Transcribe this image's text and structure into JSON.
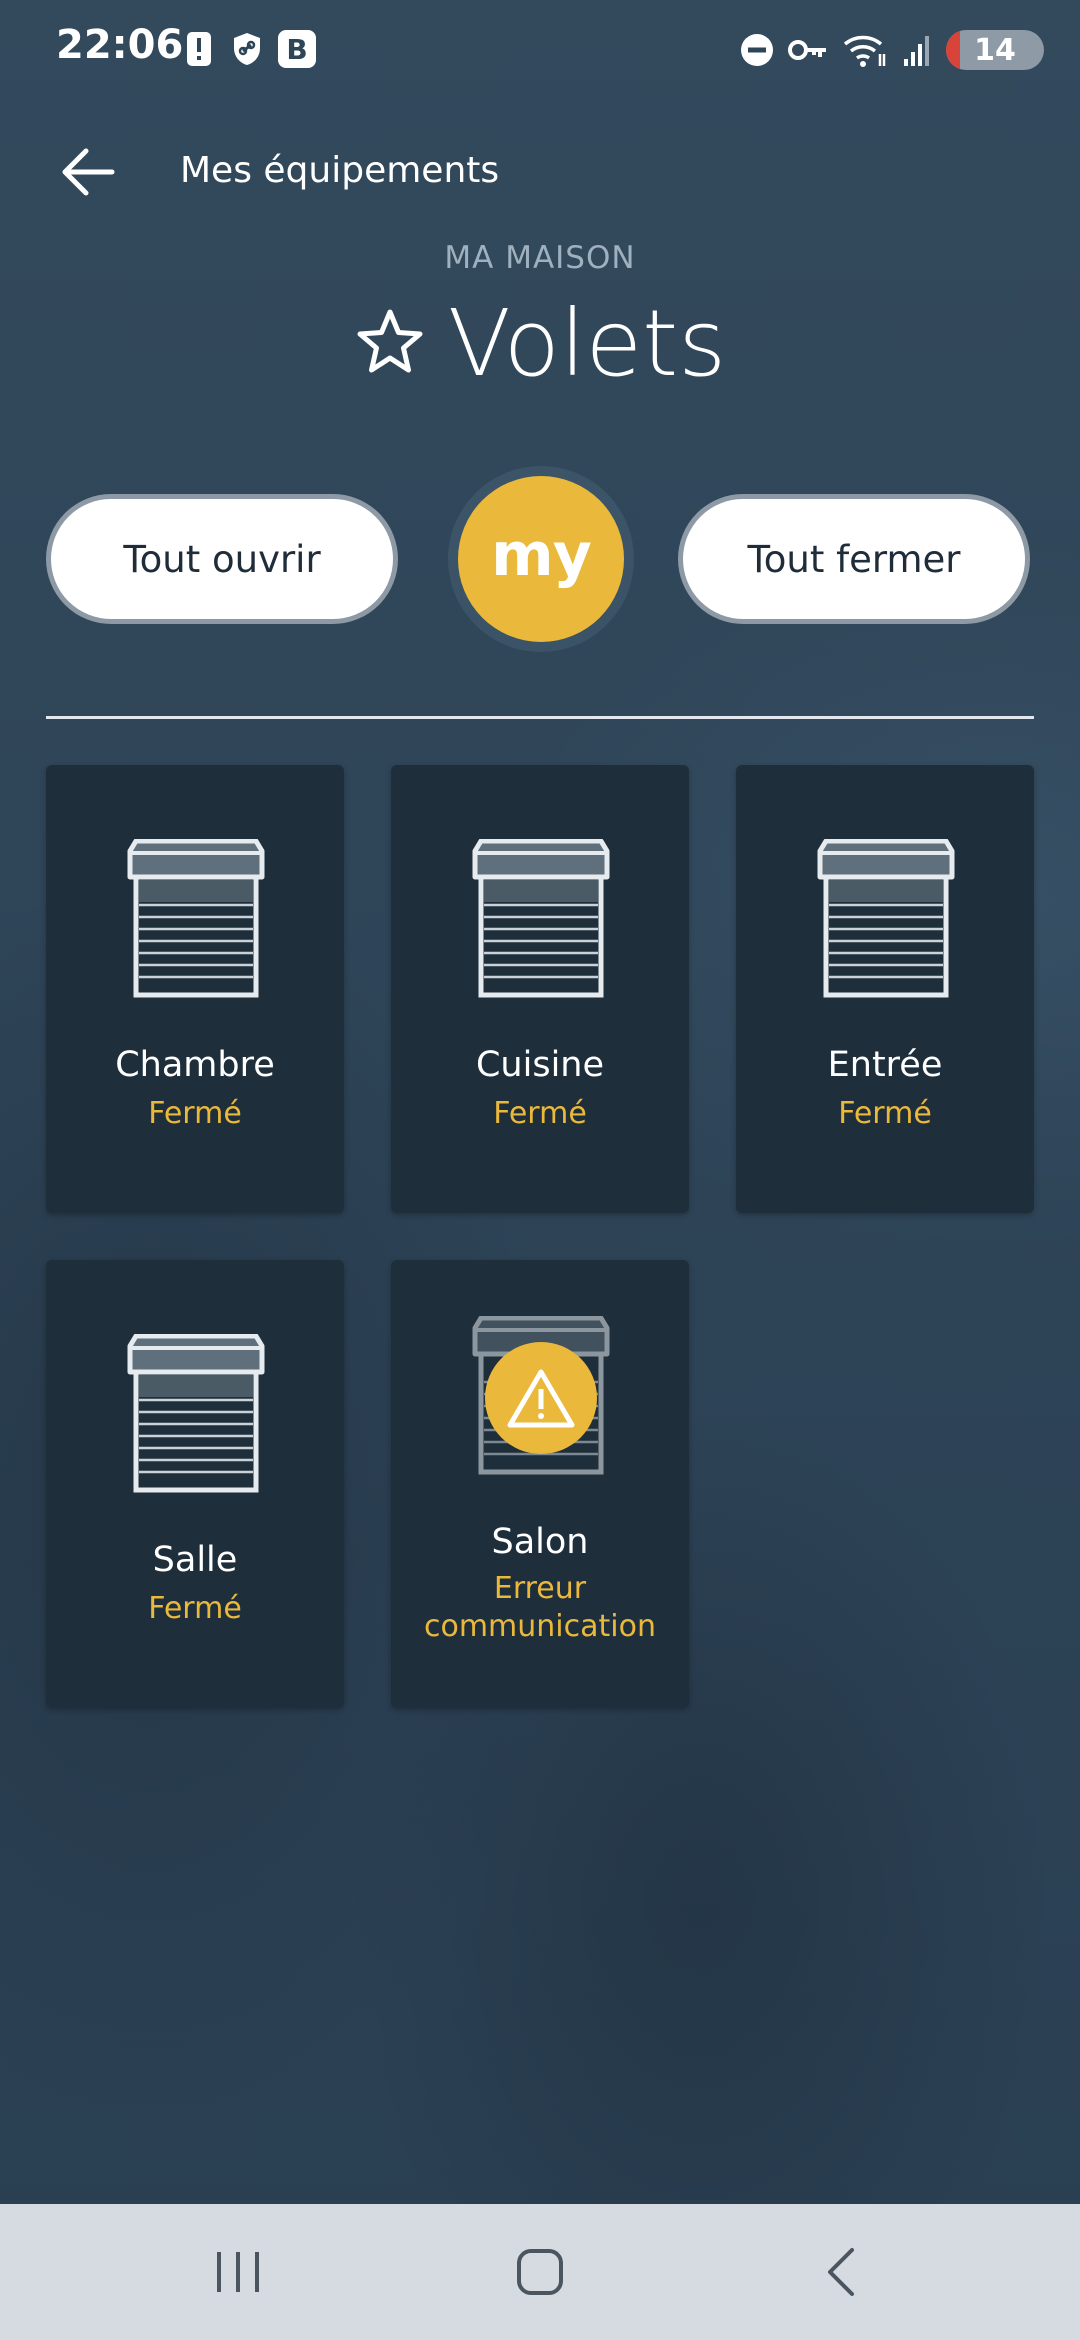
{
  "status_bar": {
    "time": "22:06",
    "left_icons": [
      "alert-icon",
      "shield-link-icon",
      "b-app-icon"
    ],
    "b_badge": "B",
    "right_icons": [
      "dnd-icon",
      "vpn-key-icon",
      "wifi-icon",
      "signal-icon"
    ],
    "battery": "14"
  },
  "header": {
    "back_icon": "arrow-left-icon",
    "title": "Mes équipements"
  },
  "page": {
    "subtitle": "MA MAISON",
    "title": "Volets",
    "favorite_icon": "star-outline-icon"
  },
  "actions": {
    "open_all": "Tout ouvrir",
    "my_label": "my",
    "close_all": "Tout fermer"
  },
  "colors": {
    "accent": "#eab83a",
    "background": "#2e4457",
    "tile": "#1f2e3b"
  },
  "devices": [
    {
      "name": "Chambre",
      "state": "Fermé",
      "icon": "roller-shutter-icon"
    },
    {
      "name": "Cuisine",
      "state": "Fermé",
      "icon": "roller-shutter-icon"
    },
    {
      "name": "Entrée",
      "state": "Fermé",
      "icon": "roller-shutter-icon"
    },
    {
      "name": "Salle",
      "state": "Fermé",
      "icon": "roller-shutter-icon"
    },
    {
      "name": "Salon",
      "state": "Erreur communication",
      "icon": "warning-icon"
    }
  ],
  "nav": {
    "recents": "recents-icon",
    "home": "home-icon",
    "back": "back-icon"
  }
}
